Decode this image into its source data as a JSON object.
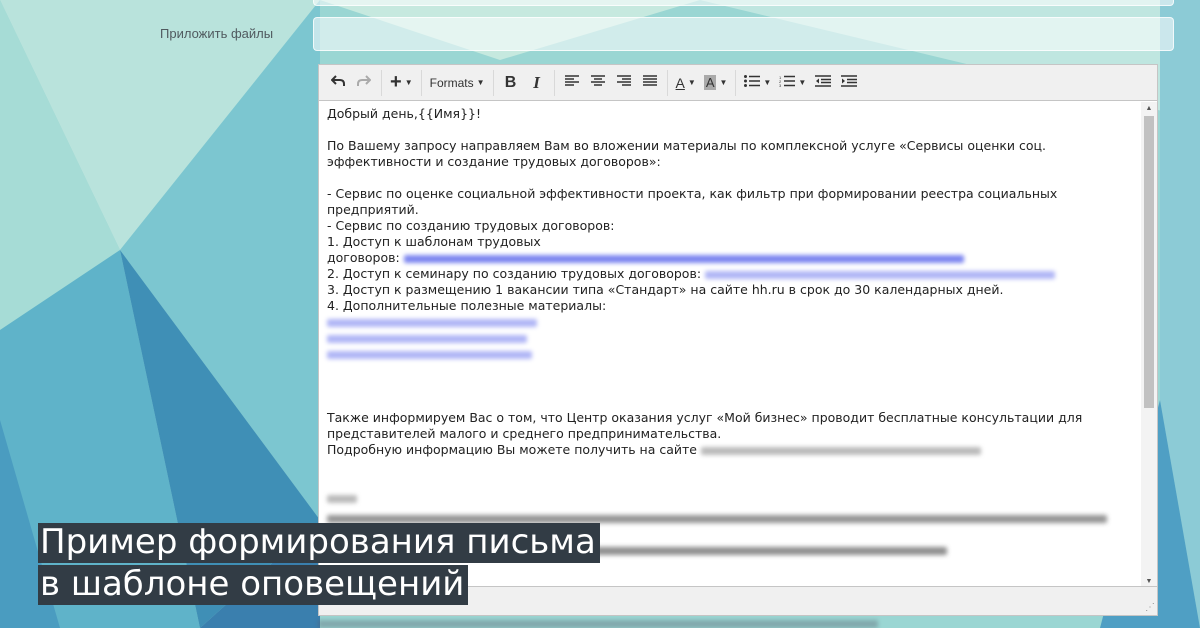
{
  "form": {
    "attach_label": "Приложить файлы"
  },
  "toolbar": {
    "undo_icon": "undo-icon",
    "redo_icon": "redo-icon",
    "insert_label": "+",
    "formats_label": "Formats",
    "bold_label": "B",
    "italic_label": "I",
    "text_color_label": "A",
    "bg_color_label": "A"
  },
  "editor": {
    "greeting": "Добрый день,{{Имя}}!",
    "intro": "По Вашему запросу направляем Вам во вложении материалы по комплексной услуге «Сервисы оценки соц. эффективности и создание трудовых договоров»:",
    "item1": "- Сервис по оценке социальной эффективности проекта, как фильтр при формировании реестра социальных предприятий.",
    "item2": "- Сервис по созданию трудовых договоров:",
    "sub1a": "1. Доступ к шаблонам трудовых",
    "sub1b": "договоров:",
    "sub2": "2. Доступ к семинару по созданию трудовых договоров:",
    "sub3": "3. Доступ к размещению 1 вакансии типа «Стандарт» на сайте hh.ru в срок до 30 календарных дней.",
    "sub4": "4. Дополнительные полезные материалы:",
    "info1": "Также информируем Вас о том, что Центр оказания услуг «Мой бизнес» проводит бесплатные консультации для представителей малого и среднего предпринимательства.",
    "info2": "Подробную информацию Вы можете получить на сайте"
  },
  "caption": {
    "line1": "Пример формирования письма",
    "line2": "в шаблоне оповещений"
  }
}
